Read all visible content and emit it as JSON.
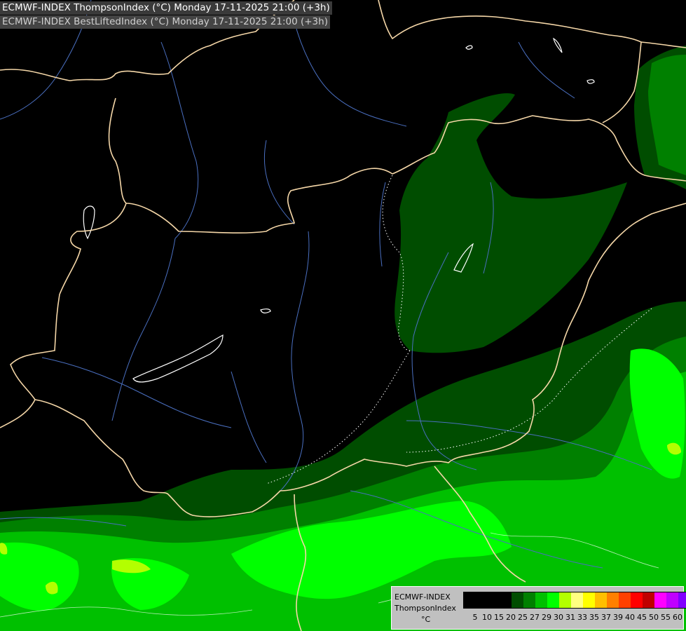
{
  "header": {
    "line1": "ECMWF-INDEX ThompsonIndex (°C) Monday 17-11-2025 21:00 (+3h)",
    "line2": "ECMWF-INDEX BestLiftedIndex (°C) Monday 17-11-2025 21:00 (+3h)"
  },
  "legend": {
    "title": "ECMWF-INDEX",
    "variable": "ThompsonIndex",
    "unit": "°C",
    "swatches": [
      "#000000",
      "#000000",
      "#000000",
      "#000000",
      "#004d00",
      "#008000",
      "#00c000",
      "#00ff00",
      "#b3ff00",
      "#ffff80",
      "#ffff00",
      "#ffbf00",
      "#ff8000",
      "#ff4000",
      "#ff0000",
      "#c00000",
      "#ff00ff",
      "#c000ff",
      "#8000ff",
      "#0000ff"
    ],
    "ticks": [
      "5",
      "10",
      "15",
      "20",
      "25",
      "27",
      "29",
      "30",
      "31",
      "33",
      "35",
      "37",
      "39",
      "40",
      "45",
      "50",
      "55",
      "60"
    ]
  },
  "colors": {
    "background": "#000000",
    "level_25": "#004d00",
    "level_27": "#008000",
    "level_29": "#00c000",
    "level_30": "#00ff00",
    "level_31": "#b3ff00",
    "borders": "#f5d7a8",
    "rivers": "#4a6fc0",
    "lakes": "#ffffff"
  }
}
